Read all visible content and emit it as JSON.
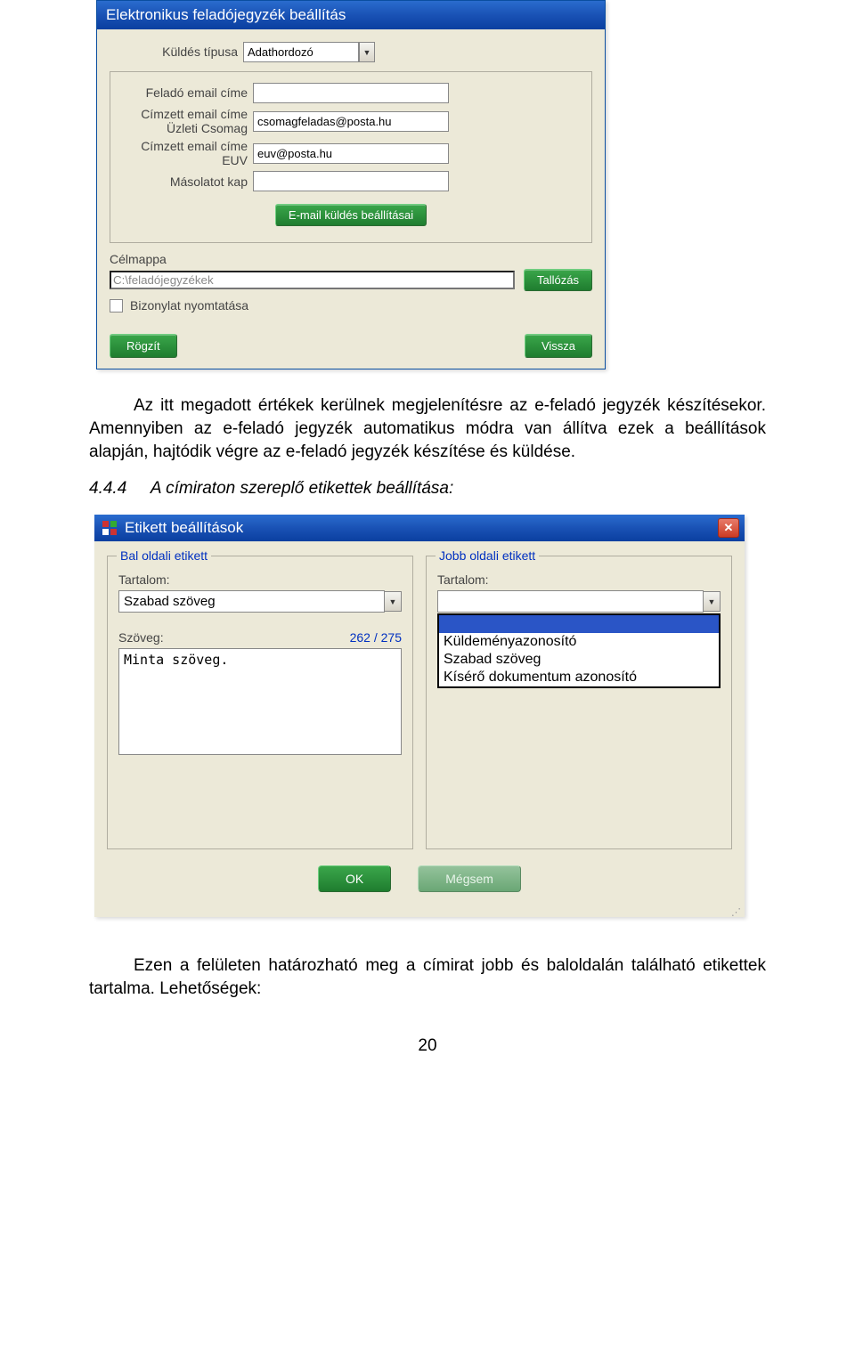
{
  "dialog1": {
    "title": "Elektronikus feladójegyzék beállítás",
    "kuldes_tipusa_label": "Küldés típusa",
    "kuldes_tipusa_value": "Adathordozó",
    "felado_email_label": "Feladó email címe",
    "felado_email_value": "",
    "cimzett1_label_l1": "Címzett email címe",
    "cimzett1_label_l2": "Üzleti Csomag",
    "cimzett1_value": "csomagfeladas@posta.hu",
    "cimzett2_label_l1": "Címzett email címe",
    "cimzett2_label_l2": "EUV",
    "cimzett2_value": "euv@posta.hu",
    "masolat_label": "Másolatot kap",
    "masolat_value": "",
    "email_settings_button": "E-mail küldés beállításai",
    "celmappa_label": "Célmappa",
    "celmappa_value": "C:\\feladójegyzékek",
    "tallozas_button": "Tallózás",
    "bizonylat_label": "Bizonylat nyomtatása",
    "rogzit_button": "Rögzít",
    "vissza_button": "Vissza"
  },
  "text1": "Az itt megadott értékek kerülnek megjelenítésre az e-feladó jegyzék készítésekor. Amennyiben az e-feladó jegyzék automatikus módra van állítva ezek a beállítások alapján, hajtódik végre az e-feladó jegyzék készítése és küldése.",
  "section": {
    "num": "4.4.4",
    "title": "A címiraton szereplő etikettek beállítása:"
  },
  "dialog2": {
    "title": "Etikett beállítások",
    "left": {
      "legend": "Bal oldali etikett",
      "tartalom_label": "Tartalom:",
      "combo_value": "Szabad szöveg",
      "szoveg_label": "Szöveg:",
      "count": "262 / 275",
      "text_value": "Minta szöveg."
    },
    "right": {
      "legend": "Jobb oldali etikett",
      "tartalom_label": "Tartalom:",
      "combo_value": "",
      "options": [
        "",
        "Küldeményazonosító",
        "Szabad szöveg",
        "Kísérő dokumentum azonosító"
      ]
    },
    "ok_button": "OK",
    "cancel_button": "Mégsem"
  },
  "text2": "Ezen a felületen határozható meg a címirat jobb és baloldalán található etikettek tartalma. Lehetőségek:",
  "page_number": "20"
}
